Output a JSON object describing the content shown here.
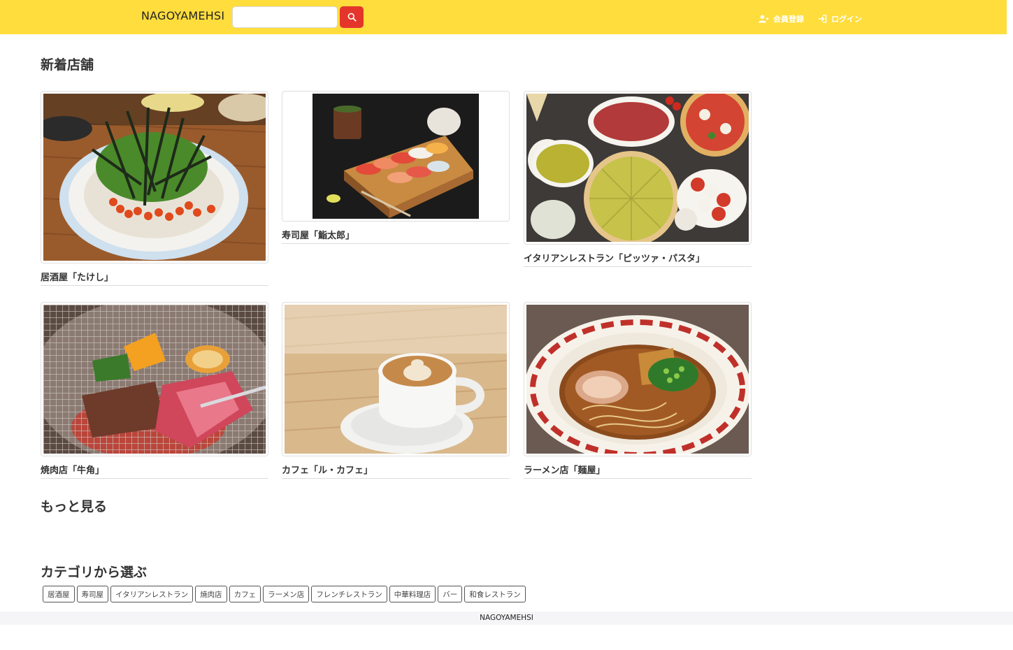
{
  "header": {
    "brand": "NAGOYAMEHSI",
    "search_placeholder": "",
    "search_icon": "search-icon",
    "signup_label": "会員登録",
    "signup_icon": "user-plus-icon",
    "login_label": "ログイン",
    "login_icon": "login-icon",
    "colors": {
      "navbar_bg": "#ffdd3c",
      "search_button": "#e4352b"
    }
  },
  "new_shops": {
    "title": "新着店舗",
    "items": [
      {
        "name": "居酒屋「たけし」",
        "image": "ikura-chirashi-bowl-photo"
      },
      {
        "name": "寿司屋「鮨太郎」",
        "image": "sushi-platter-photo"
      },
      {
        "name": "イタリアンレストラン「ピッツァ・パスタ」",
        "image": "pizza-pasta-spread-photo"
      },
      {
        "name": "焼肉店「牛角」",
        "image": "grilled-beef-photo"
      },
      {
        "name": "カフェ「ル・カフェ」",
        "image": "latte-art-photo"
      },
      {
        "name": "ラーメン店「麺屋」",
        "image": "ramen-bowl-photo"
      }
    ],
    "more_label": "もっと見る"
  },
  "categories": {
    "title": "カテゴリから選ぶ",
    "items": [
      "居酒屋",
      "寿司屋",
      "イタリアンレストラン",
      "焼肉店",
      "カフェ",
      "ラーメン店",
      "フレンチレストラン",
      "中華料理店",
      "バー",
      "和食レストラン"
    ]
  },
  "footer": {
    "text": "NAGOYAMEHSI"
  }
}
